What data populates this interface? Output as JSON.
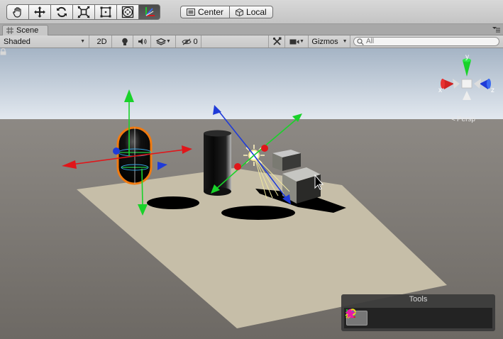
{
  "toolbar": {
    "tools": [
      {
        "name": "hand-tool",
        "icon": "hand-icon",
        "active": false
      },
      {
        "name": "move-tool",
        "icon": "move-icon",
        "active": false
      },
      {
        "name": "rotate-tool",
        "icon": "rotate-icon",
        "active": false
      },
      {
        "name": "scale-tool",
        "icon": "scale-icon",
        "active": false
      },
      {
        "name": "rect-tool",
        "icon": "rect-icon",
        "active": false
      },
      {
        "name": "transform-tool",
        "icon": "transform-icon",
        "active": false
      },
      {
        "name": "custom-tool",
        "icon": "custom-axis-icon",
        "active": true
      }
    ],
    "pivot_mode_label": "Center",
    "pivot_rotation_label": "Local"
  },
  "tab": {
    "title": "Scene"
  },
  "scene_toolbar": {
    "shading_mode": "Shaded",
    "mode_2d_label": "2D",
    "hidden_count": "0",
    "gizmos_label": "Gizmos",
    "search_placeholder": "All"
  },
  "viewport": {
    "projection_label": "Persp",
    "gizmo_axes": {
      "x": "x",
      "y": "y",
      "z": "z"
    }
  },
  "tools_panel": {
    "title": "Tools",
    "buttons": [
      {
        "name": "axis-tool",
        "icon": "custom-axis-icon",
        "active": true
      },
      {
        "name": "capsule-tool",
        "icon": "c-icon",
        "active": false
      },
      {
        "name": "light-tool",
        "icon": "comet-icon",
        "active": false
      },
      {
        "name": "star-tool",
        "icon": "star-icon",
        "active": false
      }
    ]
  },
  "colors": {
    "sky_top": "#a6b5c6",
    "sky_horizon": "#dfe6ee",
    "ground": "#7a7670",
    "plane": "#c5bca6",
    "axis_x": "#e0161a",
    "axis_y": "#19d22a",
    "axis_z": "#1f3bd8",
    "selection": "#f07a10",
    "magenta": "#e81aa8",
    "yellow": "#e8e41a"
  }
}
